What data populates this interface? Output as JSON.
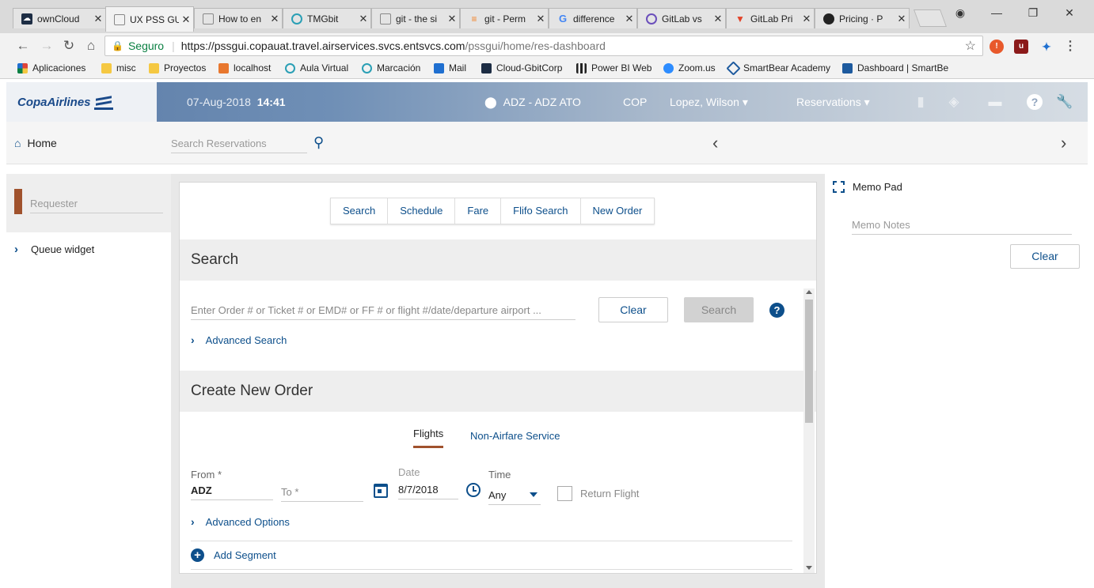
{
  "browser": {
    "tabs": [
      {
        "title": "ownCloud",
        "icon": "owncloud-icon",
        "color": "#1d2d44"
      },
      {
        "title": "UX PSS GUI",
        "icon": "page-icon",
        "color": "#888888"
      },
      {
        "title": "How to en",
        "icon": "page-icon",
        "color": "#888888"
      },
      {
        "title": "TMGbit",
        "icon": "tmgbit-icon",
        "color": "#2a9fb5"
      },
      {
        "title": "git - the si",
        "icon": "page-icon",
        "color": "#888888"
      },
      {
        "title": "git - Perm",
        "icon": "stackoverflow-icon",
        "color": "#f48024"
      },
      {
        "title": "difference",
        "icon": "google-icon",
        "color": "#4285f4"
      },
      {
        "title": "GitLab vs",
        "icon": "gitlab-circle-icon",
        "color": "#6b4fbb"
      },
      {
        "title": "GitLab Pri",
        "icon": "gitlab-icon",
        "color": "#e24329"
      },
      {
        "title": "Pricing · P",
        "icon": "github-icon",
        "color": "#222222"
      }
    ],
    "url_secure_label": "Seguro",
    "url_host": "https://pssgui.copauat.travel.airservices.svcs.entsvcs.com",
    "url_path": "/pssgui/home/res-dashboard",
    "bookmarks": [
      {
        "label": "Aplicaciones",
        "color": "#e0443a"
      },
      {
        "label": "misc",
        "color": "#f5c842"
      },
      {
        "label": "Proyectos",
        "color": "#f5c842"
      },
      {
        "label": "localhost",
        "color": "#e8772e"
      },
      {
        "label": "Aula Virtual",
        "color": "#2a9fb5"
      },
      {
        "label": "Marcación",
        "color": "#2a9fb5"
      },
      {
        "label": "Mail",
        "color": "#1f6fd0"
      },
      {
        "label": "Cloud-GbitCorp",
        "color": "#1d2d44"
      },
      {
        "label": "Power BI Web",
        "color": "#222222"
      },
      {
        "label": "Zoom.us",
        "color": "#2d8cff"
      },
      {
        "label": "SmartBear Academy",
        "color": "#1d5a9e"
      },
      {
        "label": "Dashboard | SmartBe",
        "color": "#1d5a9e"
      }
    ]
  },
  "app": {
    "logo": "CopaAirlines",
    "date": "07-Aug-2018",
    "time": "14:41",
    "station": "ADZ - ADZ ATO",
    "currency": "COP",
    "user": "Lopez, Wilson ▾",
    "reservations_menu": "Reservations ▾",
    "home_label": "Home",
    "search_placeholder": "Search Reservations"
  },
  "left": {
    "requester_placeholder": "Requester",
    "queue_widget": "Queue widget"
  },
  "center": {
    "tabs": [
      "Search",
      "Schedule",
      "Fare",
      "Flifo Search",
      "New Order"
    ],
    "search_title": "Search",
    "search_placeholder": "Enter Order # or Ticket # or EMD# or FF # or flight #/date/departure airport ...",
    "clear_label": "Clear",
    "search_label": "Search",
    "advanced_search": "Advanced Search",
    "create_title": "Create New Order",
    "subtab_flights": "Flights",
    "subtab_nonairfare": "Non-Airfare Service",
    "from_label": "From *",
    "from_value": "ADZ",
    "to_label": "To *",
    "date_label": "Date",
    "date_value": "8/7/2018",
    "time_label": "Time",
    "time_value": "Any",
    "return_flight": "Return Flight",
    "advanced_options": "Advanced Options",
    "add_segment": "Add Segment"
  },
  "right": {
    "memo_title": "Memo Pad",
    "memo_placeholder": "Memo Notes",
    "clear_label": "Clear"
  }
}
